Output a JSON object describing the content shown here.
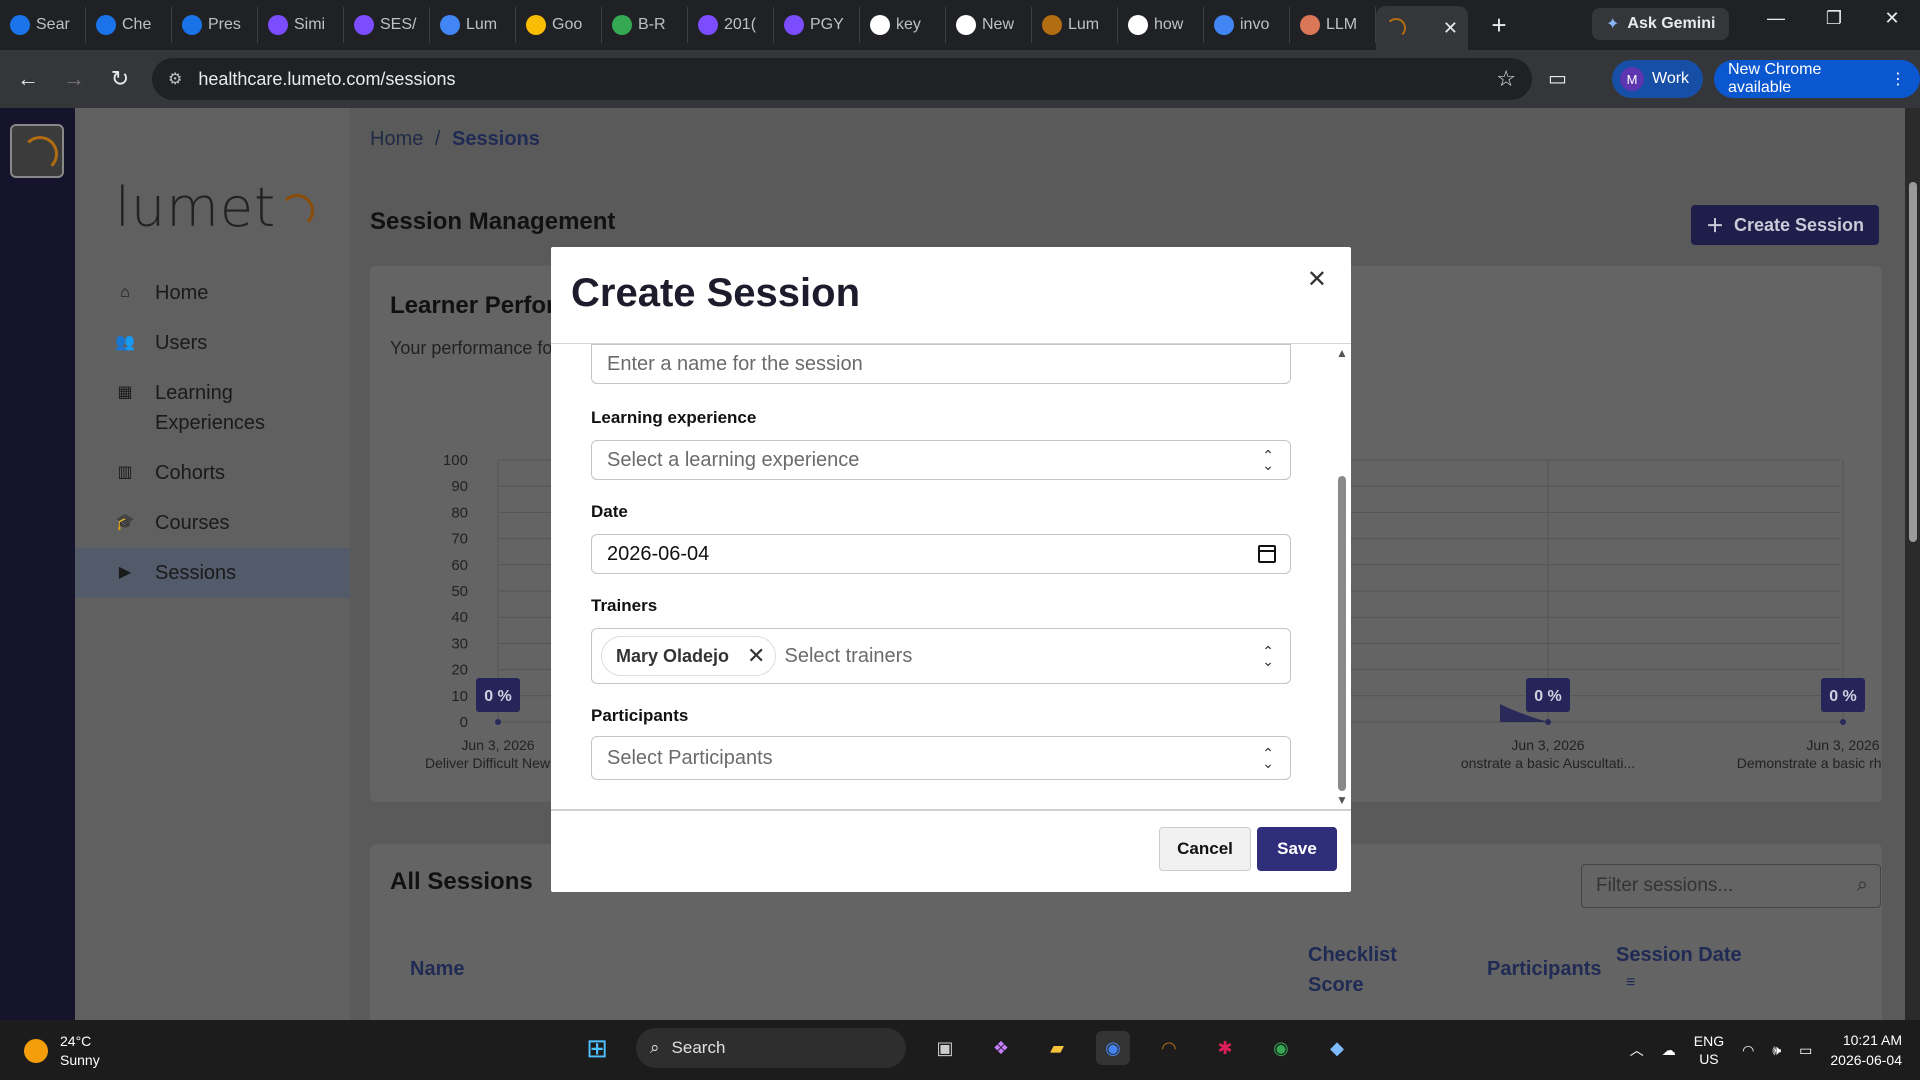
{
  "browser": {
    "tabs": [
      {
        "label": "Sear",
        "icon": "circle-c-icon",
        "color": "#1a73e8"
      },
      {
        "label": "Che",
        "icon": "circle-c-icon",
        "color": "#1a73e8"
      },
      {
        "label": "Pres",
        "icon": "circle-c-icon",
        "color": "#1a73e8"
      },
      {
        "label": "Simi",
        "icon": "video-icon",
        "color": "#7c4dff"
      },
      {
        "label": "SES/",
        "icon": "video-icon",
        "color": "#7c4dff"
      },
      {
        "label": "Lum",
        "icon": "number-4-icon",
        "color": "#4285f4"
      },
      {
        "label": "Goo",
        "icon": "meet-icon",
        "color": "#fbbc04"
      },
      {
        "label": "B-R",
        "icon": "drive-icon",
        "color": "#34a853"
      },
      {
        "label": "201(",
        "icon": "play-icon",
        "color": "#7c4dff"
      },
      {
        "label": "PGY",
        "icon": "play-icon",
        "color": "#7c4dff"
      },
      {
        "label": "key",
        "icon": "google-icon",
        "color": "#ffffff"
      },
      {
        "label": "New",
        "icon": "chatgpt-icon",
        "color": "#ffffff"
      },
      {
        "label": "Lum",
        "icon": "lumeto-icon",
        "color": "#b26c12"
      },
      {
        "label": "how",
        "icon": "google-icon",
        "color": "#ffffff"
      },
      {
        "label": "invo",
        "icon": "docs-icon",
        "color": "#4285f4"
      },
      {
        "label": "LLM",
        "icon": "claude-icon",
        "color": "#d97757"
      }
    ],
    "ask_gemini": "Ask Gemini",
    "url": "healthcare.lumeto.com/sessions",
    "profile_initial": "M",
    "profile_label": "Work",
    "update_label": "New Chrome available"
  },
  "sidebar": {
    "brand": "lumet",
    "items": [
      {
        "label": "Home",
        "icon": "home-icon"
      },
      {
        "label": "Users",
        "icon": "users-icon"
      },
      {
        "label": "Learning Experiences",
        "icon": "grid-icon"
      },
      {
        "label": "Cohorts",
        "icon": "book-icon"
      },
      {
        "label": "Courses",
        "icon": "graduation-cap-icon"
      },
      {
        "label": "Sessions",
        "icon": "play-icon",
        "active": true
      }
    ]
  },
  "main": {
    "breadcrumb": {
      "home": "Home",
      "separator": "/",
      "current": "Sessions"
    },
    "title": "Session Management",
    "create_button": "Create Session",
    "performance": {
      "title": "Learner Perfor",
      "subtitle": "Your performance fo"
    },
    "all_sessions": {
      "title": "All Sessions",
      "filter_placeholder": "Filter sessions...",
      "columns": [
        "Name",
        "Checklist Score",
        "Participants",
        "Session Date"
      ]
    }
  },
  "chart_data": {
    "type": "area",
    "y_ticks": [
      100,
      90,
      80,
      70,
      60,
      50,
      40,
      30,
      20,
      10,
      0
    ],
    "ylim": [
      0,
      100
    ],
    "grid": true,
    "points": [
      {
        "date": "Jun 3, 2026",
        "label": "Deliver Difficult News w",
        "value": 0,
        "value_label": "0 %"
      },
      {
        "date": "Jun 3, 2026",
        "label": "onstrate a basic Auscultati...",
        "value": 0,
        "value_label": "0 %"
      },
      {
        "date": "Jun 3, 2026",
        "label": "Demonstrate a basic rhythm ass...",
        "value": 0,
        "value_label": "0 %"
      }
    ],
    "fill_color": "#2a2a5a"
  },
  "modal": {
    "title": "Create Session",
    "name_placeholder": "Enter a name for the session",
    "learning_label": "Learning experience",
    "learning_placeholder": "Select a learning experience",
    "date_label": "Date",
    "date_value": "2026-06-04",
    "trainers_label": "Trainers",
    "trainer_chip": "Mary Oladejo",
    "trainers_placeholder": "Select trainers",
    "participants_label": "Participants",
    "participants_placeholder": "Select Participants",
    "cancel": "Cancel",
    "save": "Save"
  },
  "taskbar": {
    "temp": "24°C",
    "condition": "Sunny",
    "search": "Search",
    "lang1": "ENG",
    "lang2": "US",
    "time": "10:21 AM",
    "date": "2026-06-04"
  }
}
